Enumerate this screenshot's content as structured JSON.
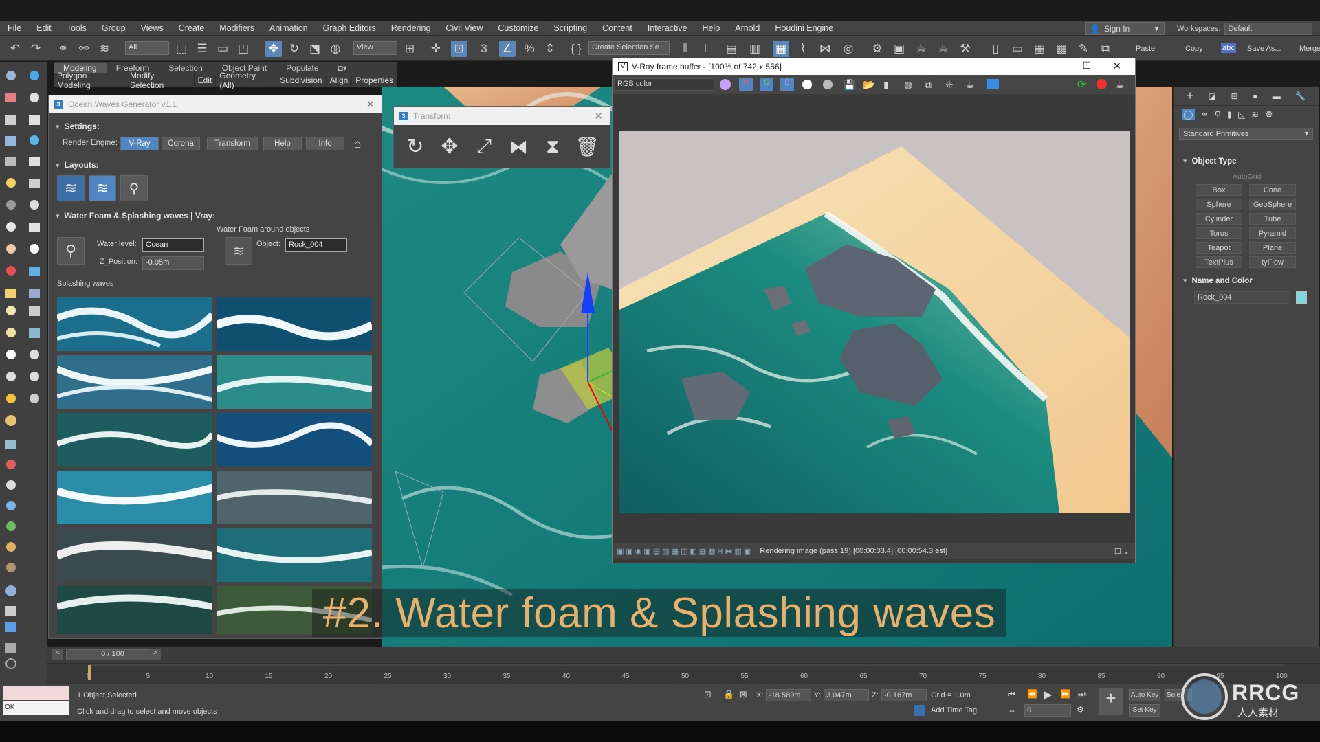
{
  "menubar": {
    "items": [
      "File",
      "Edit",
      "Tools",
      "Group",
      "Views",
      "Create",
      "Modifiers",
      "Animation",
      "Graph Editors",
      "Rendering",
      "Civil View",
      "Customize",
      "Scripting",
      "Content",
      "Interactive",
      "Help",
      "Arnold",
      "Houdini Engine"
    ],
    "sign_in": "Sign In",
    "workspaces_label": "Workspaces:",
    "workspace_value": "Default"
  },
  "toolbar": {
    "filter_value": "All",
    "view_value": "View",
    "selection_set": "Create Selection Se",
    "paste": "Paste",
    "copy": "Copy",
    "abc": "abc",
    "save_as": "Save As...",
    "merge": "Merge"
  },
  "ribbon": {
    "tabs": [
      "Modeling",
      "Freeform",
      "Selection",
      "Object Paint",
      "Populate"
    ],
    "sub": [
      "Polygon Modeling",
      "Modify Selection",
      "Edit",
      "Geometry (All)",
      "Subdivision",
      "Align",
      "Properties"
    ]
  },
  "ocean": {
    "title": "Ocean Waves Generator v1.1",
    "settings": "Settings:",
    "render_engine_label": "Render Engine:",
    "buttons": [
      "V-Ray",
      "Corona",
      "Transform",
      "Help",
      "Info"
    ],
    "layouts": "Layouts:",
    "section": "Water Foam & Splashing waves | Vray:",
    "foam_around": "Water Foam around objects",
    "water_level_label": "Water level:",
    "water_level_value": "Ocean",
    "z_position_label": "Z_Position:",
    "z_position_value": "-0.05m",
    "object_label": "Object:",
    "object_value": "Rock_004",
    "splashing": "Splashing waves"
  },
  "transform": {
    "title": "Transform"
  },
  "vfb": {
    "title": "V-Ray frame buffer - [100% of 742 x 556]",
    "channel": "RGB color",
    "status": "Rendering image (pass 19) [00:00:03.4] [00:00:54.3 est]"
  },
  "cmd": {
    "category": "Standard Primitives",
    "object_type": "Object Type",
    "autogrid": "AutoGrid",
    "primitives": [
      "Box",
      "Cone",
      "Sphere",
      "GeoSphere",
      "Cylinder",
      "Tube",
      "Torus",
      "Pyramid",
      "Teapot",
      "Plane",
      "TextPlus",
      "tyFlow"
    ],
    "name_color": "Name and Color",
    "name_value": "Rock_004",
    "swatch": "#7fd8e0"
  },
  "timeline": {
    "frame": "0 / 100",
    "ticks": [
      "0",
      "5",
      "10",
      "15",
      "20",
      "25",
      "30",
      "35",
      "40",
      "45",
      "50",
      "55",
      "60",
      "65",
      "70",
      "75",
      "80",
      "85",
      "90",
      "95",
      "100"
    ]
  },
  "status": {
    "selected": "1 Object Selected",
    "hint": "Click and drag to select and move objects",
    "ok": "OK",
    "x_label": "X:",
    "x_value": "-18.589m",
    "y_label": "Y:",
    "y_value": "3.047m",
    "z_label": "Z:",
    "z_value": "-0.167m",
    "grid": "Grid = 1.0m",
    "add_time_tag": "Add Time Tag",
    "auto_key": "Auto Key",
    "set_key": "Set Key",
    "sel": "Sele",
    "frame_value": "0"
  },
  "caption": "#2. Water foam & Splashing waves",
  "watermark": "RRCG",
  "watermark_sub": "人人素材"
}
